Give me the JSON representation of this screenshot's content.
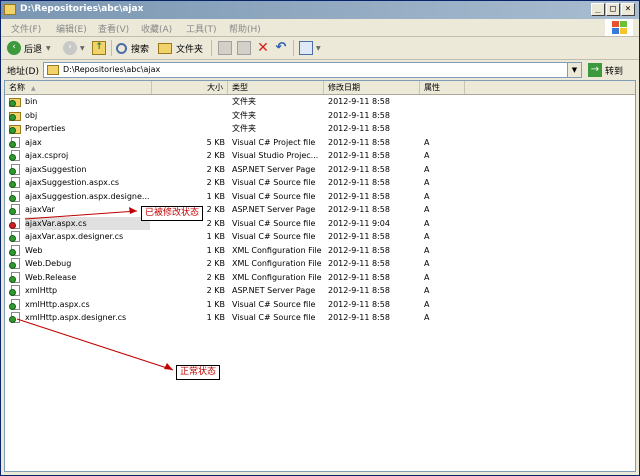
{
  "window": {
    "title": "D:\\Repositories\\abc\\ajax"
  },
  "menu": [
    "文件(F)",
    "编辑(E)",
    "查看(V)",
    "收藏(A)",
    "工具(T)",
    "帮助(H)"
  ],
  "toolbar": {
    "back": "后退",
    "search": "搜索",
    "folders": "文件夹"
  },
  "address": {
    "label": "地址(D)",
    "path": "D:\\Repositories\\abc\\ajax",
    "go": "转到"
  },
  "columns": {
    "name": "名称",
    "size": "大小",
    "type": "类型",
    "date": "修改日期",
    "attr": "属性"
  },
  "files": [
    {
      "name": "bin",
      "size": "",
      "type": "文件夹",
      "date": "2012-9-11 8:58",
      "attr": "",
      "kind": "folder",
      "status": "normal"
    },
    {
      "name": "obj",
      "size": "",
      "type": "文件夹",
      "date": "2012-9-11 8:58",
      "attr": "",
      "kind": "folder",
      "status": "normal"
    },
    {
      "name": "Properties",
      "size": "",
      "type": "文件夹",
      "date": "2012-9-11 8:58",
      "attr": "",
      "kind": "folder",
      "status": "normal"
    },
    {
      "name": "ajax",
      "size": "5 KB",
      "type": "Visual C# Project file",
      "date": "2012-9-11 8:58",
      "attr": "A",
      "kind": "file",
      "status": "normal"
    },
    {
      "name": "ajax.csproj",
      "size": "2 KB",
      "type": "Visual Studio Projec...",
      "date": "2012-9-11 8:58",
      "attr": "A",
      "kind": "file",
      "status": "normal"
    },
    {
      "name": "ajaxSuggestion",
      "size": "2 KB",
      "type": "ASP.NET Server Page",
      "date": "2012-9-11 8:58",
      "attr": "A",
      "kind": "file",
      "status": "normal"
    },
    {
      "name": "ajaxSuggestion.aspx.cs",
      "size": "2 KB",
      "type": "Visual C# Source file",
      "date": "2012-9-11 8:58",
      "attr": "A",
      "kind": "file",
      "status": "normal"
    },
    {
      "name": "ajaxSuggestion.aspx.designe...",
      "size": "1 KB",
      "type": "Visual C# Source file",
      "date": "2012-9-11 8:58",
      "attr": "A",
      "kind": "file",
      "status": "normal"
    },
    {
      "name": "ajaxVar",
      "size": "2 KB",
      "type": "ASP.NET Server Page",
      "date": "2012-9-11 8:58",
      "attr": "A",
      "kind": "file",
      "status": "normal"
    },
    {
      "name": "ajaxVar.aspx.cs",
      "size": "2 KB",
      "type": "Visual C# Source file",
      "date": "2012-9-11 9:04",
      "attr": "A",
      "kind": "file",
      "status": "modified"
    },
    {
      "name": "ajaxVar.aspx.designer.cs",
      "size": "1 KB",
      "type": "Visual C# Source file",
      "date": "2012-9-11 8:58",
      "attr": "A",
      "kind": "file",
      "status": "normal"
    },
    {
      "name": "Web",
      "size": "1 KB",
      "type": "XML Configuration File",
      "date": "2012-9-11 8:58",
      "attr": "A",
      "kind": "file",
      "status": "normal"
    },
    {
      "name": "Web.Debug",
      "size": "2 KB",
      "type": "XML Configuration File",
      "date": "2012-9-11 8:58",
      "attr": "A",
      "kind": "file",
      "status": "normal"
    },
    {
      "name": "Web.Release",
      "size": "2 KB",
      "type": "XML Configuration File",
      "date": "2012-9-11 8:58",
      "attr": "A",
      "kind": "file",
      "status": "normal"
    },
    {
      "name": "xmlHttp",
      "size": "2 KB",
      "type": "ASP.NET Server Page",
      "date": "2012-9-11 8:58",
      "attr": "A",
      "kind": "file",
      "status": "normal"
    },
    {
      "name": "xmlHttp.aspx.cs",
      "size": "1 KB",
      "type": "Visual C# Source file",
      "date": "2012-9-11 8:58",
      "attr": "A",
      "kind": "file",
      "status": "normal"
    },
    {
      "name": "xmlHttp.aspx.designer.cs",
      "size": "1 KB",
      "type": "Visual C# Source file",
      "date": "2012-9-11 8:58",
      "attr": "A",
      "kind": "file",
      "status": "normal"
    }
  ],
  "annotations": {
    "modified": "已被修改状态",
    "normal": "正常状态"
  },
  "colors": {
    "title_bar": "#7a96b2",
    "normal_status": "#2e9a2e",
    "modified_status": "#cc2222",
    "annotation_text": "#c00000"
  }
}
